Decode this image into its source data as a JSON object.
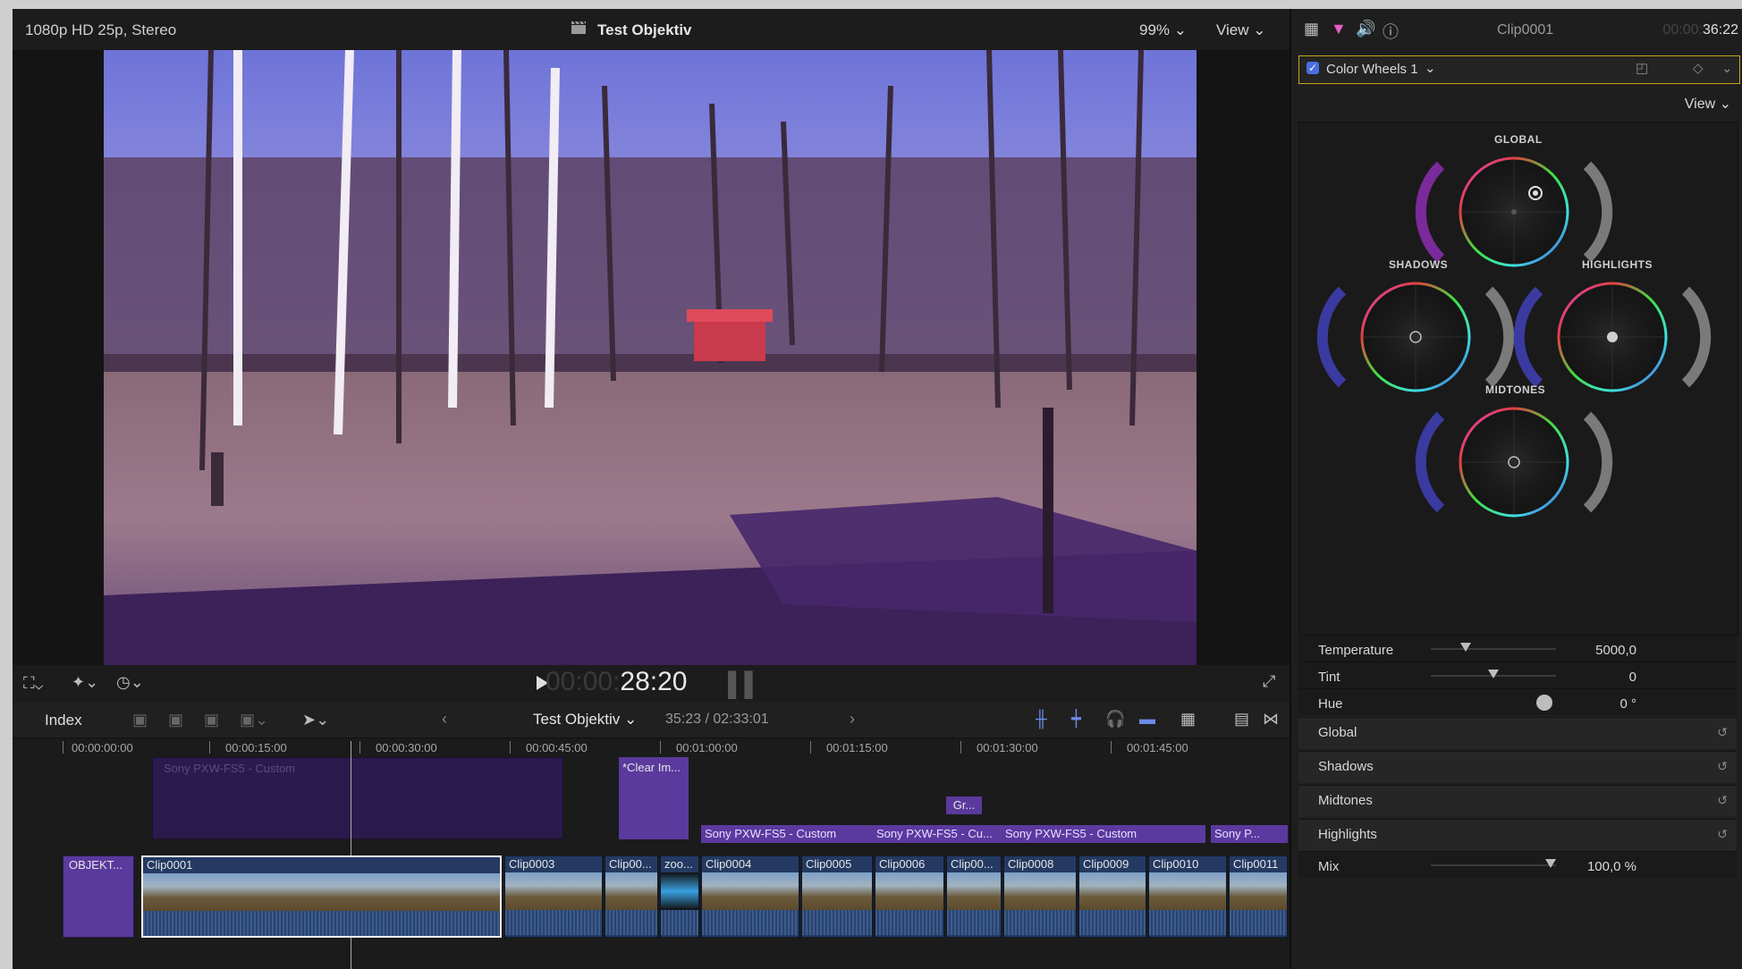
{
  "viewer": {
    "format": "1080p HD 25p, Stereo",
    "title": "Test Objektiv",
    "zoom": "99%",
    "view": "View",
    "timecode_dim": "00:00:",
    "timecode_bright": "28:20"
  },
  "timeline": {
    "index": "Index",
    "project": "Test Objektiv",
    "duration": "35:23 / 02:33:01",
    "ruler": [
      "00:00:00:00",
      "00:00:15:00",
      "00:00:30:00",
      "00:00:45:00",
      "00:01:00:00",
      "00:01:15:00",
      "00:01:30:00",
      "00:01:45:00"
    ],
    "upper_clips": [
      "Sony PXW-FS5 - Custom",
      "*Clear Im..."
    ],
    "gr_label": "Gr...",
    "connected": [
      "Sony PXW-FS5 - Custom",
      "Sony PXW-FS5 - Cu...",
      "Sony PXW-FS5 - Custom",
      "Sony P..."
    ],
    "primary": [
      "OBJEKT...",
      "Clip0001",
      "Clip0003",
      "Clip00...",
      "zoo...",
      "Clip0004",
      "Clip0005",
      "Clip0006",
      "Clip00...",
      "Clip0008",
      "Clip0009",
      "Clip0010",
      "Clip0011"
    ]
  },
  "inspector": {
    "clip_name": "Clip0001",
    "timecode_dim": "00:00:",
    "timecode_bright": "36:22",
    "effect": "Color Wheels 1",
    "view": "View",
    "wheels": {
      "global": "GLOBAL",
      "shadows": "SHADOWS",
      "highlights": "HIGHLIGHTS",
      "midtones": "MIDTONES"
    },
    "params": [
      {
        "name": "Temperature",
        "value": "5000,0"
      },
      {
        "name": "Tint",
        "value": "0"
      },
      {
        "name": "Hue",
        "value": "0 °"
      }
    ],
    "sections": [
      "Global",
      "Shadows",
      "Midtones",
      "Highlights"
    ],
    "mix": {
      "name": "Mix",
      "value": "100,0 %"
    }
  },
  "colors": {
    "accent_yellow": "#c9a418",
    "clip_purple": "#5a3a9c",
    "clip_blue": "#243a62"
  }
}
